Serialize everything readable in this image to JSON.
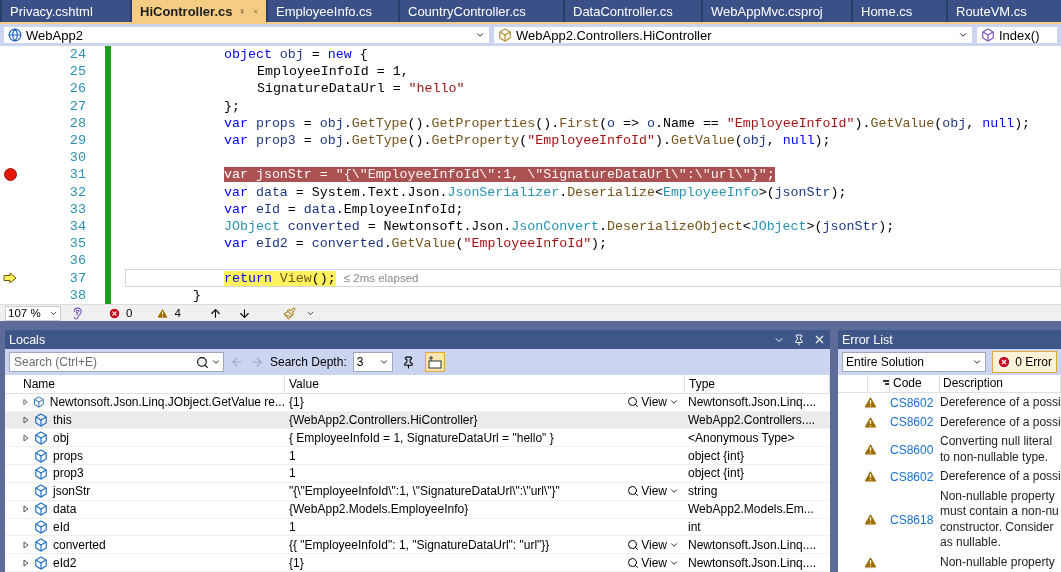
{
  "tabs": [
    {
      "label": "Privacy.cshtml",
      "selected": false
    },
    {
      "label": "HiController.cs",
      "selected": true
    },
    {
      "label": "EmployeeInfo.cs",
      "selected": false
    },
    {
      "label": "CountryController.cs",
      "selected": false
    },
    {
      "label": "DataController.cs",
      "selected": false
    },
    {
      "label": "WebAppMvc.csproj",
      "selected": false
    },
    {
      "label": "Home.cs",
      "selected": false
    },
    {
      "label": "RouteVM.cs",
      "selected": false
    }
  ],
  "navigation": {
    "project": "WebApp2",
    "class": "WebApp2.Controllers.HiController",
    "member": "Index()"
  },
  "code": {
    "lines": [
      {
        "number": "24",
        "kind": "statement",
        "breakpoint": false,
        "current": false,
        "segments": [
          {
            "kind": "kw",
            "text": "object "
          },
          {
            "kind": "local",
            "text": "obj"
          },
          {
            "kind": "plain",
            "text": " = "
          },
          {
            "kind": "kw",
            "text": "new"
          },
          {
            "kind": "plain",
            "text": " {"
          }
        ]
      },
      {
        "number": "25",
        "kind": "initializer",
        "breakpoint": false,
        "current": false,
        "segments": [
          {
            "kind": "plain",
            "text": "EmployeeInfoId = 1,"
          }
        ]
      },
      {
        "number": "26",
        "kind": "initializer",
        "breakpoint": false,
        "current": false,
        "segments": [
          {
            "kind": "plain",
            "text": "SignatureDataUrl = "
          },
          {
            "kind": "str",
            "text": "\"hello\""
          }
        ]
      },
      {
        "number": "27",
        "kind": "statement",
        "breakpoint": false,
        "current": false,
        "segments": [
          {
            "kind": "plain",
            "text": "};"
          }
        ]
      },
      {
        "number": "28",
        "kind": "statement",
        "breakpoint": false,
        "current": false,
        "segments": [
          {
            "kind": "kw",
            "text": "var "
          },
          {
            "kind": "local",
            "text": "props"
          },
          {
            "kind": "plain",
            "text": " = "
          },
          {
            "kind": "local",
            "text": "obj"
          },
          {
            "kind": "plain",
            "text": "."
          },
          {
            "kind": "method",
            "text": "GetType"
          },
          {
            "kind": "plain",
            "text": "()."
          },
          {
            "kind": "method",
            "text": "GetProperties"
          },
          {
            "kind": "plain",
            "text": "()."
          },
          {
            "kind": "method",
            "text": "First"
          },
          {
            "kind": "plain",
            "text": "("
          },
          {
            "kind": "local",
            "text": "o"
          },
          {
            "kind": "plain",
            "text": " => "
          },
          {
            "kind": "local",
            "text": "o"
          },
          {
            "kind": "plain",
            "text": ".Name == "
          },
          {
            "kind": "str",
            "text": "\"EmployeeInfoId\""
          },
          {
            "kind": "plain",
            "text": ")."
          },
          {
            "kind": "method",
            "text": "GetValue"
          },
          {
            "kind": "plain",
            "text": "("
          },
          {
            "kind": "local",
            "text": "obj"
          },
          {
            "kind": "plain",
            "text": ", "
          },
          {
            "kind": "kw",
            "text": "null"
          },
          {
            "kind": "plain",
            "text": ");"
          }
        ]
      },
      {
        "number": "29",
        "kind": "statement",
        "breakpoint": false,
        "current": false,
        "segments": [
          {
            "kind": "kw",
            "text": "var "
          },
          {
            "kind": "local",
            "text": "prop3"
          },
          {
            "kind": "plain",
            "text": " = "
          },
          {
            "kind": "local",
            "text": "obj"
          },
          {
            "kind": "plain",
            "text": "."
          },
          {
            "kind": "method",
            "text": "GetType"
          },
          {
            "kind": "plain",
            "text": "()."
          },
          {
            "kind": "method",
            "text": "GetProperty"
          },
          {
            "kind": "plain",
            "text": "("
          },
          {
            "kind": "str",
            "text": "\"EmployeeInfoId\""
          },
          {
            "kind": "plain",
            "text": ")."
          },
          {
            "kind": "method",
            "text": "GetValue"
          },
          {
            "kind": "plain",
            "text": "("
          },
          {
            "kind": "local",
            "text": "obj"
          },
          {
            "kind": "plain",
            "text": ", "
          },
          {
            "kind": "kw",
            "text": "null"
          },
          {
            "kind": "plain",
            "text": ");"
          }
        ]
      },
      {
        "number": "30",
        "kind": "statement",
        "breakpoint": false,
        "current": false
      },
      {
        "number": "31",
        "kind": "statement",
        "breakpoint": true,
        "current": false,
        "segments": [
          {
            "kind": "kw",
            "text": "var"
          },
          {
            "kind": "plain",
            "text": " jsonStr = "
          },
          {
            "kind": "str",
            "text": "\"{\\\"EmployeeInfoId\\\":1, \\\"SignatureDataUrl\\\":\\\"url\\\"}\""
          },
          {
            "kind": "plain",
            "text": ";"
          }
        ]
      },
      {
        "number": "32",
        "kind": "statement",
        "breakpoint": false,
        "current": false,
        "segments": [
          {
            "kind": "kw",
            "text": "var "
          },
          {
            "kind": "local",
            "text": "data"
          },
          {
            "kind": "plain",
            "text": " = System.Text.Json."
          },
          {
            "kind": "type",
            "text": "JsonSerializer"
          },
          {
            "kind": "plain",
            "text": "."
          },
          {
            "kind": "method",
            "text": "Deserialize"
          },
          {
            "kind": "plain",
            "text": "<"
          },
          {
            "kind": "type",
            "text": "EmployeeInfo"
          },
          {
            "kind": "plain",
            "text": ">("
          },
          {
            "kind": "local",
            "text": "jsonStr"
          },
          {
            "kind": "plain",
            "text": ");"
          }
        ]
      },
      {
        "number": "33",
        "kind": "statement",
        "breakpoint": false,
        "current": false,
        "segments": [
          {
            "kind": "kw",
            "text": "var "
          },
          {
            "kind": "local",
            "text": "eId"
          },
          {
            "kind": "plain",
            "text": " = "
          },
          {
            "kind": "local",
            "text": "data"
          },
          {
            "kind": "plain",
            "text": ".EmployeeInfoId;"
          }
        ]
      },
      {
        "number": "34",
        "kind": "statement",
        "breakpoint": false,
        "current": false,
        "segments": [
          {
            "kind": "type",
            "text": "JObject"
          },
          {
            "kind": "local",
            "text": " converted"
          },
          {
            "kind": "plain",
            "text": " = Newtonsoft.Json."
          },
          {
            "kind": "type",
            "text": "JsonConvert"
          },
          {
            "kind": "plain",
            "text": "."
          },
          {
            "kind": "method",
            "text": "DeserializeObject"
          },
          {
            "kind": "plain",
            "text": "<"
          },
          {
            "kind": "type",
            "text": "JObject"
          },
          {
            "kind": "plain",
            "text": ">("
          },
          {
            "kind": "local",
            "text": "jsonStr"
          },
          {
            "kind": "plain",
            "text": ");"
          }
        ]
      },
      {
        "number": "35",
        "kind": "statement",
        "breakpoint": false,
        "current": false,
        "segments": [
          {
            "kind": "kw",
            "text": "var "
          },
          {
            "kind": "local",
            "text": "eId2"
          },
          {
            "kind": "plain",
            "text": " = "
          },
          {
            "kind": "local",
            "text": "converted"
          },
          {
            "kind": "plain",
            "text": "."
          },
          {
            "kind": "method",
            "text": "GetValue"
          },
          {
            "kind": "plain",
            "text": "("
          },
          {
            "kind": "str",
            "text": "\"EmployeeInfoId\""
          },
          {
            "kind": "plain",
            "text": ");"
          }
        ]
      },
      {
        "number": "36",
        "kind": "statement",
        "breakpoint": false,
        "current": false
      },
      {
        "number": "37",
        "kind": "statement",
        "breakpoint": false,
        "current": true,
        "hint": "≤ 2ms elapsed",
        "segments": [
          {
            "kind": "kw",
            "text": "return "
          },
          {
            "kind": "method",
            "text": "View"
          },
          {
            "kind": "plain",
            "text": "();"
          }
        ]
      },
      {
        "number": "38",
        "kind": "closing",
        "breakpoint": false,
        "current": false,
        "segments": [
          {
            "kind": "plain",
            "text": "}"
          }
        ]
      }
    ]
  },
  "editor_status": {
    "zoom": "107 %",
    "errors": "0",
    "warnings": "4"
  },
  "locals": {
    "title": "Locals",
    "search": {
      "placeholder": "Search (Ctrl+E)"
    },
    "search_depth_label": "Search Depth:",
    "search_depth": "3",
    "columns": [
      "Name",
      "Value",
      "Type"
    ],
    "rows": [
      {
        "name": "Newtonsoft.Json.Linq.JObject.GetValue re...",
        "value": "{1}",
        "view": "View",
        "type": "Newtonsoft.Json.Linq....",
        "expandable": true,
        "selected": false
      },
      {
        "name": "this",
        "value": "{WebApp2.Controllers.HiController}",
        "type": "WebApp2.Controllers....",
        "expandable": true,
        "selected": true
      },
      {
        "name": "obj",
        "value": "{ EmployeeInfoId = 1, SignatureDataUrl = \"hello\" }",
        "type": "<Anonymous Type>",
        "expandable": true,
        "selected": false
      },
      {
        "name": "props",
        "value": "1",
        "type": "object {int}",
        "expandable": false,
        "selected": false
      },
      {
        "name": "prop3",
        "value": "1",
        "type": "object {int}",
        "expandable": false,
        "selected": false
      },
      {
        "name": "jsonStr",
        "value": "\"{\\\"EmployeeInfoId\\\":1, \\\"SignatureDataUrl\\\":\\\"url\\\"}\"",
        "view": "View",
        "type": "string",
        "expandable": false,
        "selected": false
      },
      {
        "name": "data",
        "value": "{WebApp2.Models.EmployeeInfo}",
        "type": "WebApp2.Models.Em...",
        "expandable": true,
        "selected": false
      },
      {
        "name": "eId",
        "value": "1",
        "type": "int",
        "expandable": false,
        "selected": false
      },
      {
        "name": "converted",
        "value": "{{  \"EmployeeInfoId\": 1,  \"SignatureDataUrl\": \"url\"}}",
        "view": "View",
        "type": "Newtonsoft.Json.Linq....",
        "expandable": true,
        "selected": false
      },
      {
        "name": "eId2",
        "value": "{1}",
        "view": "View",
        "type": "Newtonsoft.Json.Linq....",
        "expandable": true,
        "selected": false
      }
    ]
  },
  "error_list": {
    "title": "Error List",
    "scope": "Entire Solution",
    "errors_button": "0 Error",
    "columns": [
      "Code",
      "Description"
    ],
    "rows": [
      {
        "kind": "warning",
        "code": "CS8602",
        "description": [
          "Dereference of a possi"
        ]
      },
      {
        "kind": "warning",
        "code": "CS8602",
        "description": [
          "Dereference of a possi"
        ]
      },
      {
        "kind": "warning",
        "code": "CS8600",
        "description": [
          "Converting null literal",
          "to non-nullable type."
        ]
      },
      {
        "kind": "warning",
        "code": "CS8602",
        "description": [
          "Dereference of a possi"
        ]
      },
      {
        "kind": "warning",
        "code": "CS8618",
        "description": [
          "Non-nullable property",
          "must contain a non-nu",
          "constructor. Consider",
          "as nullable."
        ]
      },
      {
        "kind": "warning",
        "description": [
          "Non-nullable property"
        ]
      }
    ]
  }
}
